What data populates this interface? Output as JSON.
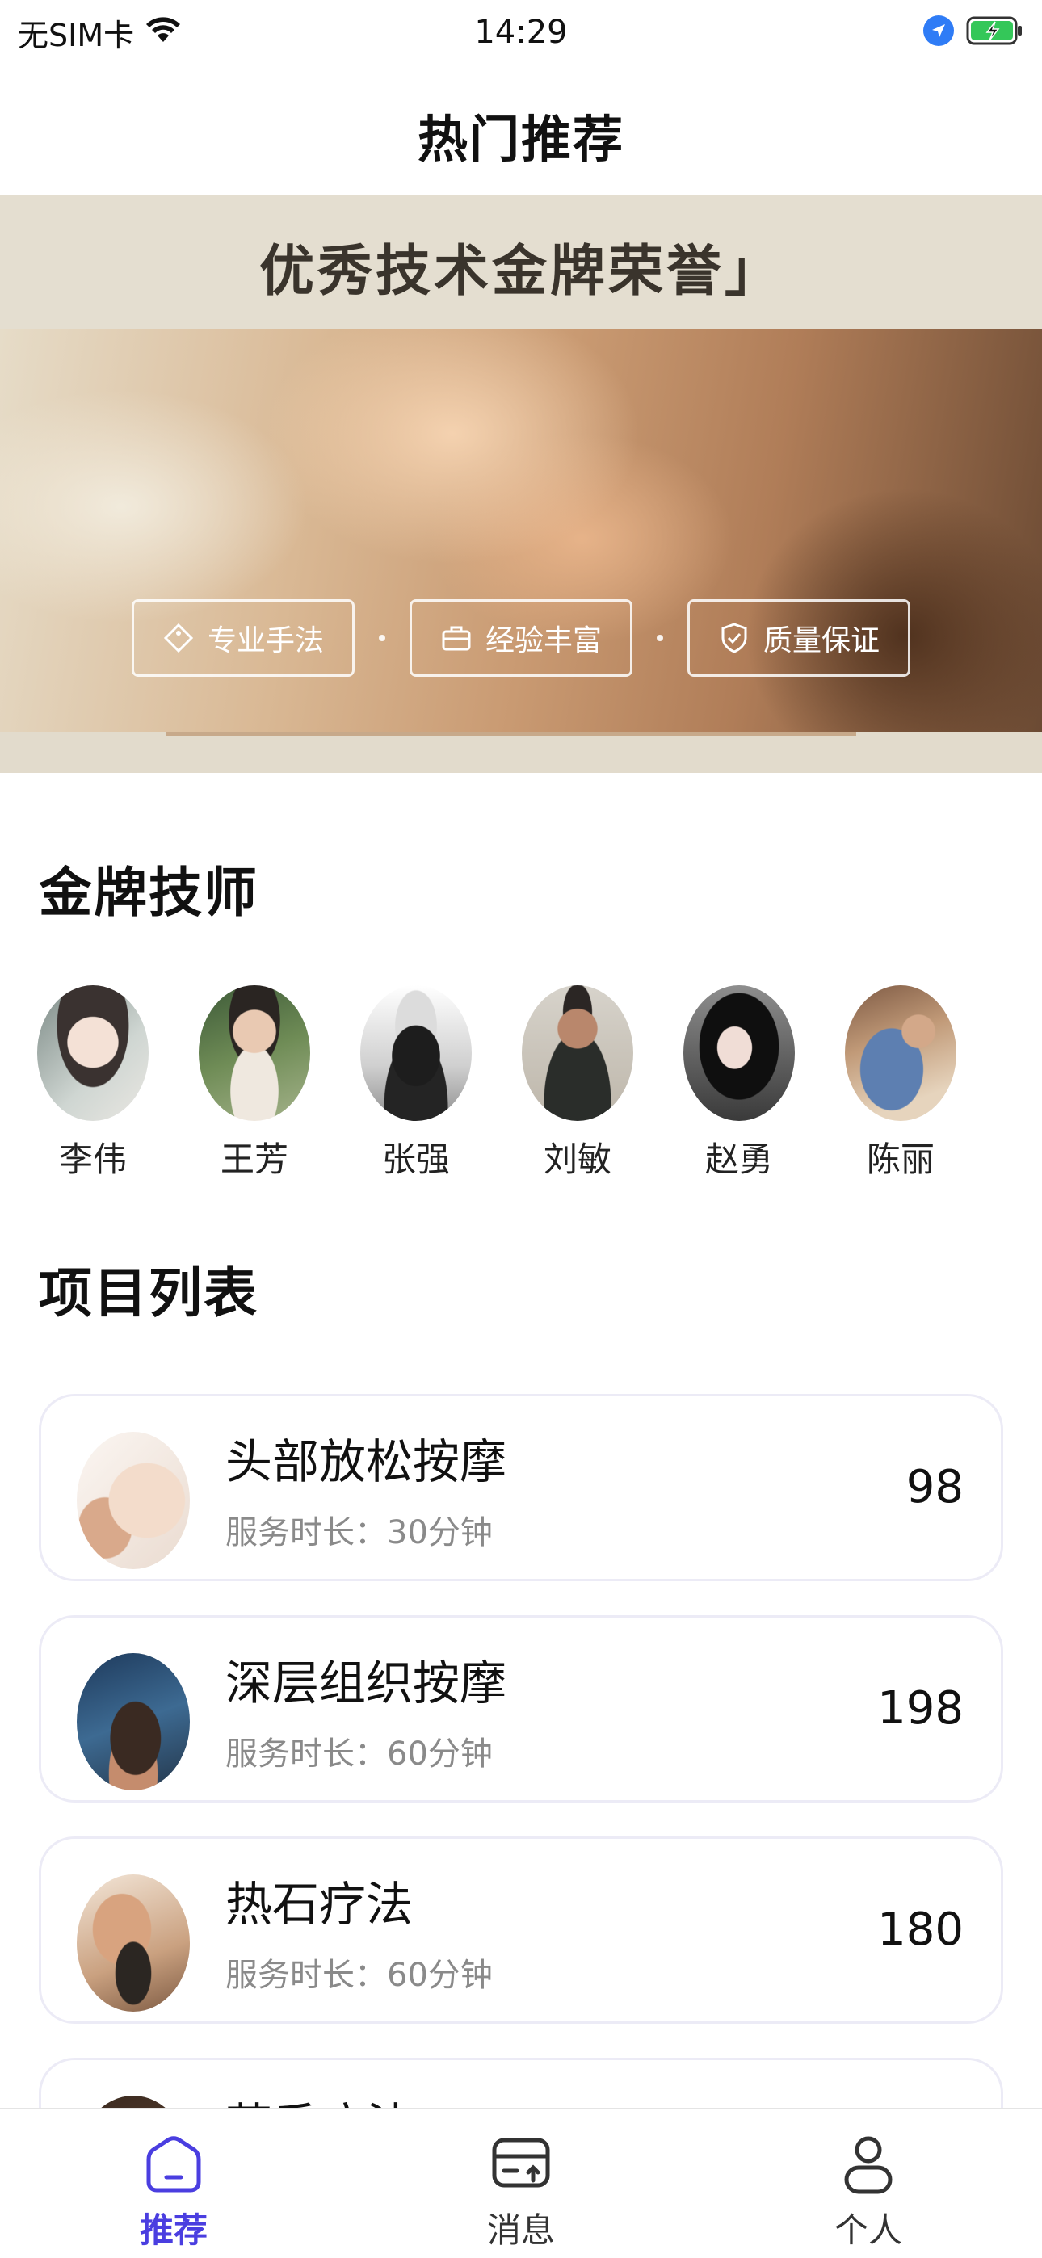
{
  "status_bar": {
    "carrier": "无SIM卡",
    "time": "14:29"
  },
  "nav": {
    "title": "热门推荐"
  },
  "banner": {
    "headline": "优秀技术金牌荣誉",
    "headline_close": "」",
    "badges": [
      {
        "label": "专业手法",
        "icon": "tag-icon"
      },
      {
        "label": "经验丰富",
        "icon": "briefcase-icon"
      },
      {
        "label": "质量保证",
        "icon": "shield-check-icon"
      }
    ]
  },
  "technicians": {
    "title": "金牌技师",
    "items": [
      {
        "name": "李伟"
      },
      {
        "name": "王芳"
      },
      {
        "name": "张强"
      },
      {
        "name": "刘敏"
      },
      {
        "name": "赵勇"
      },
      {
        "name": "陈丽"
      }
    ]
  },
  "projects": {
    "title": "项目列表",
    "items": [
      {
        "name": "头部放松按摩",
        "duration": "服务时长：30分钟",
        "price": "98"
      },
      {
        "name": "深层组织按摩",
        "duration": "服务时长：60分钟",
        "price": "198"
      },
      {
        "name": "热石疗法",
        "duration": "服务时长：60分钟",
        "price": "180"
      },
      {
        "name": "芳香疗法",
        "duration": "",
        "price": ""
      }
    ]
  },
  "tab_bar": {
    "items": [
      {
        "label": "推荐",
        "icon": "home-icon",
        "active": true
      },
      {
        "label": "消息",
        "icon": "message-icon",
        "active": false
      },
      {
        "label": "个人",
        "icon": "person-icon",
        "active": false
      }
    ]
  },
  "colors": {
    "accent": "#4a3ee0",
    "card_border": "#ecebf6",
    "secondary_text": "#8a8a8a"
  }
}
